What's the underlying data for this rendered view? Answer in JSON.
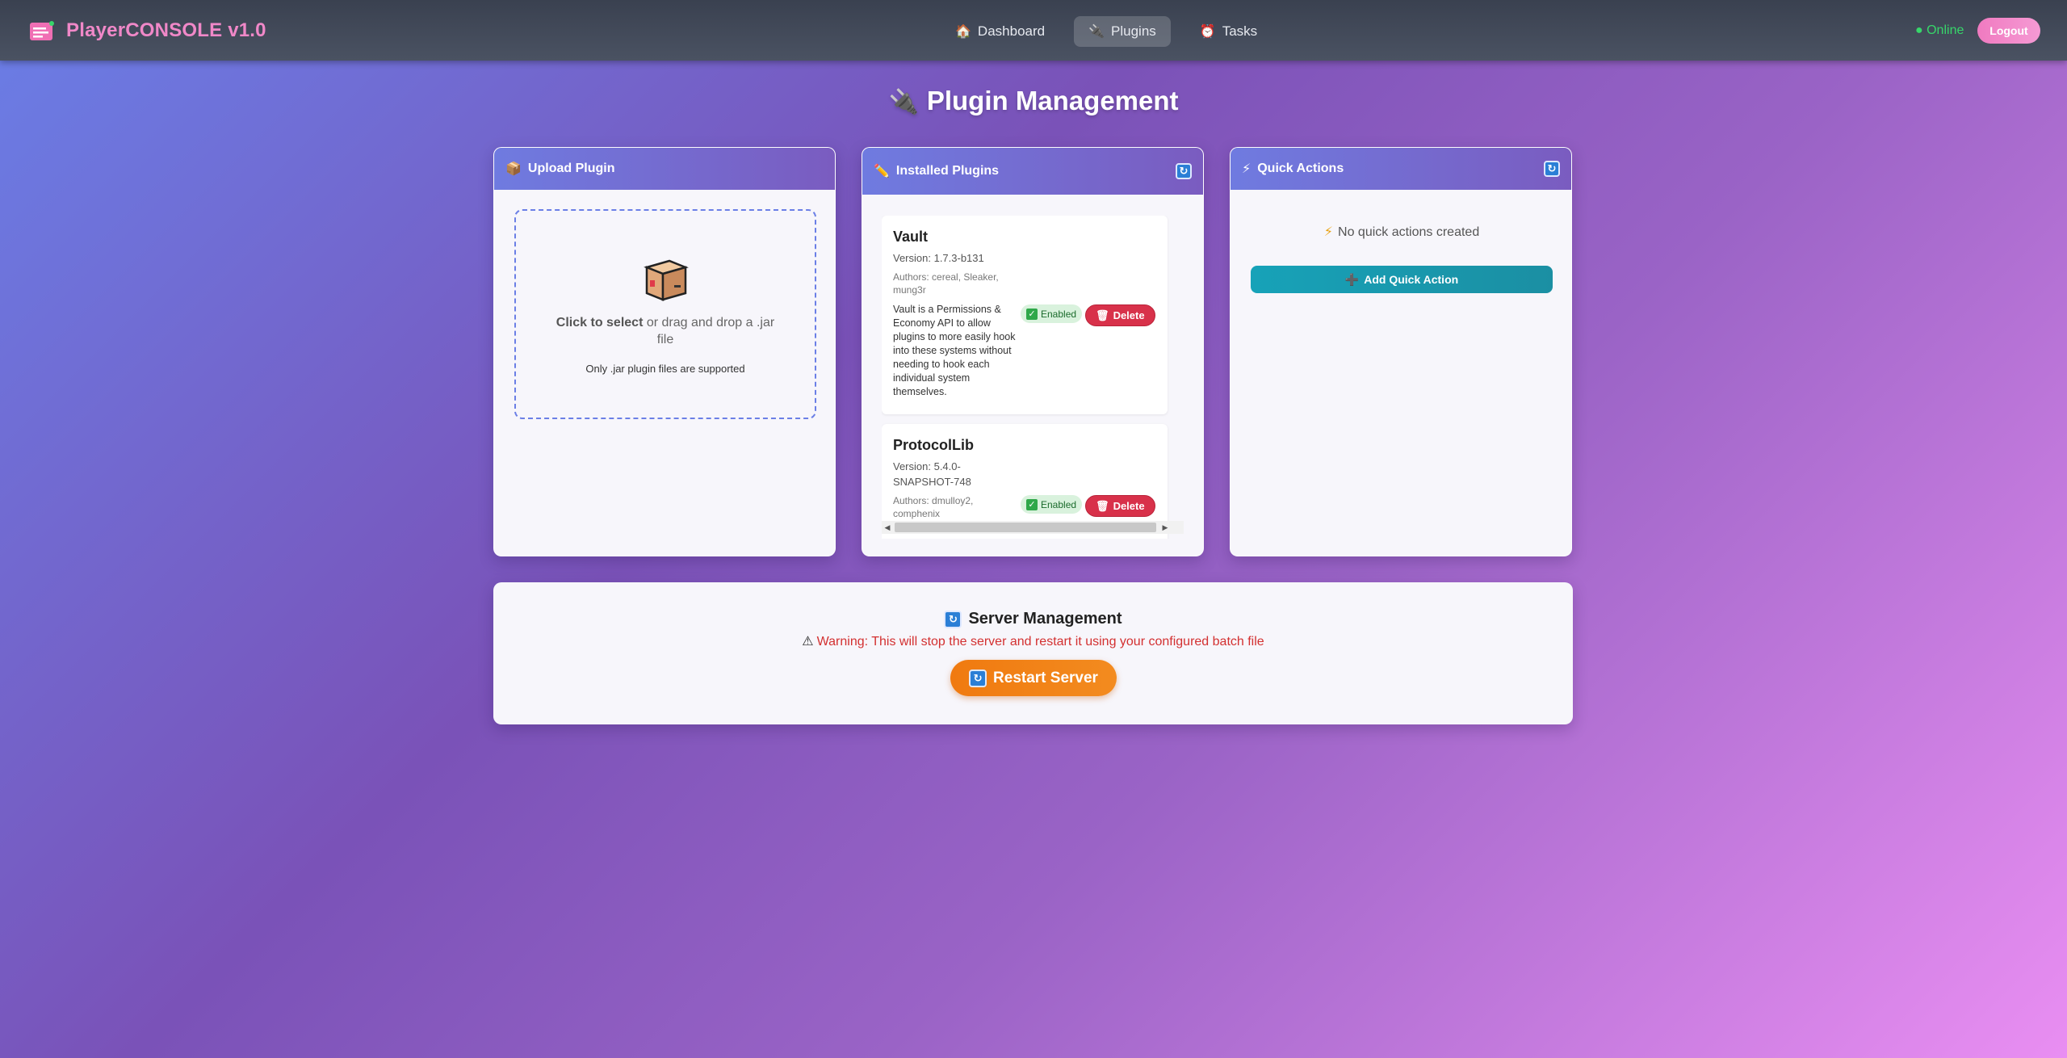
{
  "header": {
    "brand": "PlayerCONSOLE v1.0",
    "nav": [
      {
        "label": "Dashboard",
        "icon": "home-icon"
      },
      {
        "label": "Plugins",
        "icon": "plug-icon"
      },
      {
        "label": "Tasks",
        "icon": "alarm-clock-icon"
      }
    ],
    "active_nav": "Plugins",
    "status": "● Online",
    "logout_label": "Logout"
  },
  "page": {
    "title": "Plugin Management"
  },
  "upload": {
    "title": "Upload Plugin",
    "click_label": "Click to select",
    "drop_text": "or drag and drop a .jar file",
    "note": "Only .jar plugin files are supported"
  },
  "installed": {
    "title": "Installed Plugins",
    "plugins": [
      {
        "name": "Vault",
        "version": "Version: 1.7.3-b131",
        "authors": "Authors: cereal, Sleaker, mung3r",
        "description": "Vault is a Permissions & Economy API to allow plugins to more easily hook into these systems without needing to hook each individual system themselves.",
        "status": "Enabled",
        "delete_label": "Delete"
      },
      {
        "name": "ProtocolLib",
        "version": "Version: 5.4.0-SNAPSHOT-748",
        "authors": "Authors: dmulloy2, comphenix",
        "description": "",
        "status": "Enabled",
        "delete_label": "Delete"
      }
    ]
  },
  "quick_actions": {
    "title": "Quick Actions",
    "empty_text": "No quick actions created",
    "add_label": "Add Quick Action"
  },
  "server": {
    "title": "Server Management",
    "warning": "Warning: This will stop the server and restart it using your configured batch file",
    "restart_label": "Restart Server"
  },
  "colors": {
    "accent": "#6f7be0",
    "brand": "#f088c8",
    "online": "#37d66a",
    "danger": "#d8314a",
    "restart": "#f07a10",
    "teal": "#17a2b8"
  }
}
